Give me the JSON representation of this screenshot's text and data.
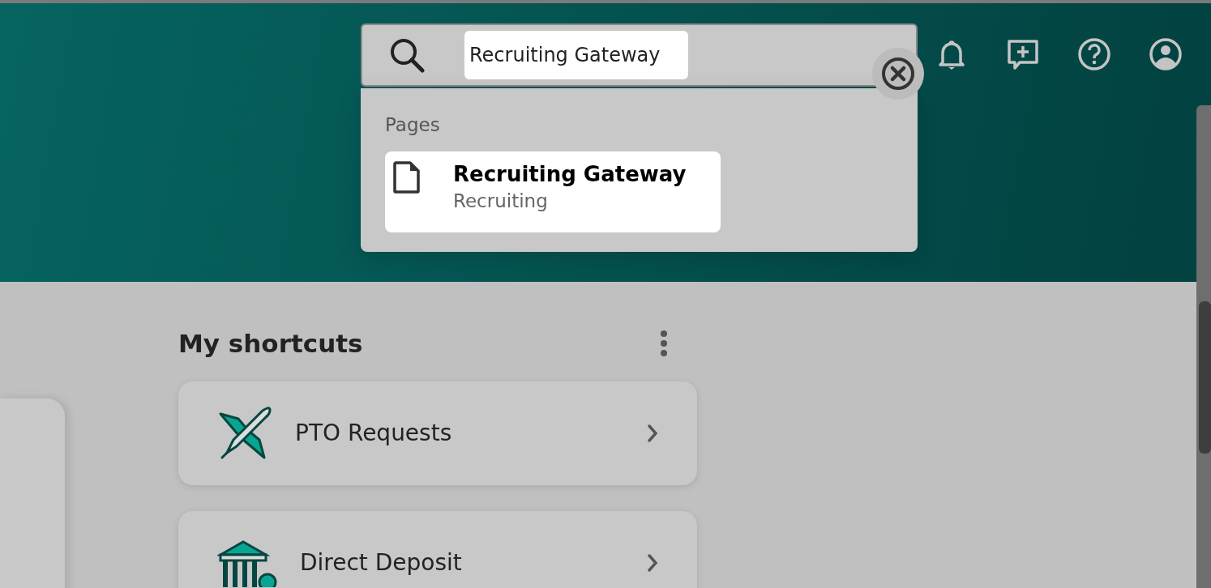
{
  "search": {
    "value": "Recruiting Gateway"
  },
  "search_results": {
    "section": "Pages",
    "results": [
      {
        "title": "Recruiting Gateway",
        "subtitle": "Recruiting",
        "selected": true
      }
    ]
  },
  "shortcuts": {
    "title": "My shortcuts",
    "items": [
      {
        "label": "PTO Requests",
        "kind": "plane"
      },
      {
        "label": "Direct Deposit",
        "kind": "bank"
      }
    ]
  }
}
